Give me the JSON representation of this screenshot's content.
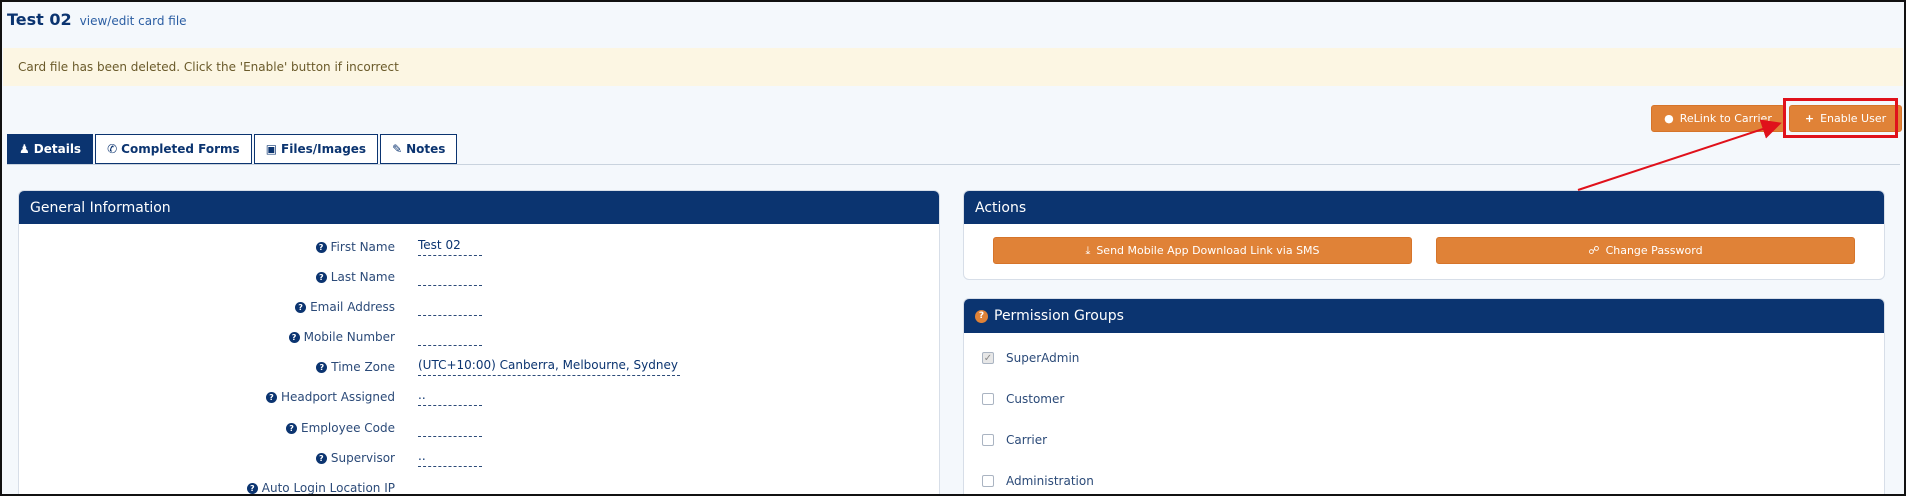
{
  "header": {
    "title": "Test 02",
    "subtitle": "view/edit card file"
  },
  "alert": {
    "message": "Card file has been deleted. Click the 'Enable' button if incorrect"
  },
  "toolbar": {
    "relink_label": "ReLink to Carrier",
    "enable_label": "Enable User",
    "relink_icon": "link-icon",
    "enable_icon": "plus-icon"
  },
  "tabs": [
    {
      "label": "Details",
      "icon": "user-icon",
      "active": true
    },
    {
      "label": "Completed Forms",
      "icon": "phone-icon",
      "active": false
    },
    {
      "label": "Files/Images",
      "icon": "image-icon",
      "active": false
    },
    {
      "label": "Notes",
      "icon": "pencil-icon",
      "active": false
    }
  ],
  "general": {
    "title": "General Information",
    "fields": [
      {
        "label": "First Name",
        "value": "Test 02"
      },
      {
        "label": "Last Name",
        "value": ""
      },
      {
        "label": "Email Address",
        "value": ""
      },
      {
        "label": "Mobile Number",
        "value": ""
      },
      {
        "label": "Time Zone",
        "value": "(UTC+10:00) Canberra, Melbourne, Sydney"
      },
      {
        "label": "Headport Assigned",
        "value": ".."
      },
      {
        "label": "Employee Code",
        "value": ""
      },
      {
        "label": "Supervisor",
        "value": ".."
      },
      {
        "label": "Auto Login Location IP",
        "value": ""
      }
    ]
  },
  "actions": {
    "title": "Actions",
    "sms_label": "Send Mobile App Download Link via SMS",
    "password_label": "Change Password"
  },
  "permissions": {
    "title": "Permission Groups",
    "groups": [
      {
        "label": "SuperAdmin",
        "checked": true
      },
      {
        "label": "Customer",
        "checked": false
      },
      {
        "label": "Carrier",
        "checked": false
      },
      {
        "label": "Administration",
        "checked": false
      }
    ]
  },
  "colors": {
    "navy": "#0b3470",
    "orange": "#e08237",
    "alert_bg": "#fcf6e3",
    "highlight": "#e0111b"
  }
}
